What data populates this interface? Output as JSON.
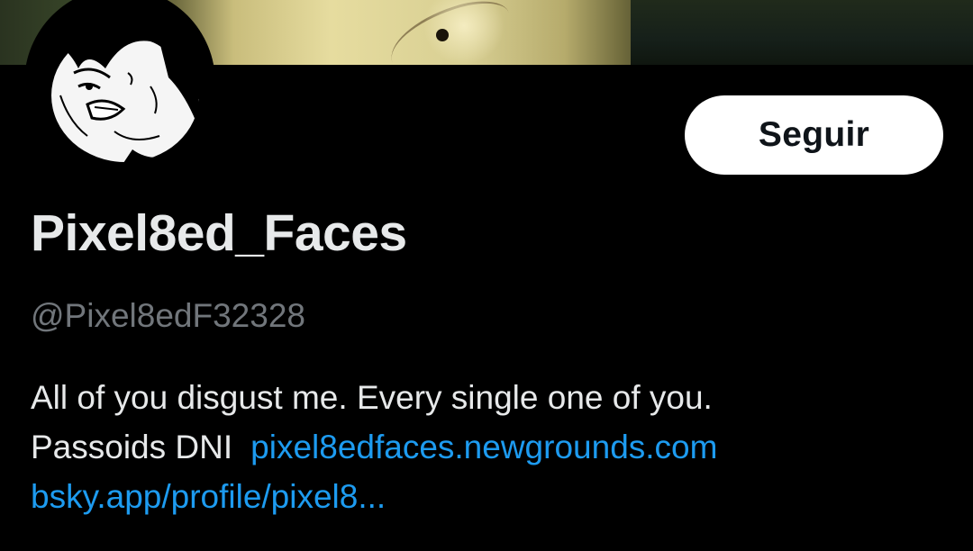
{
  "profile": {
    "display_name": "Pixel8ed_Faces",
    "handle": "@Pixel8edF32328",
    "bio": {
      "line1": "All of you disgust me. Every single one of you.",
      "line2_text": "Passoids DNI",
      "link1": "pixel8edfaces.newgrounds.com",
      "link2": "bsky.app/profile/pixel8..."
    }
  },
  "actions": {
    "follow_label": "Seguir"
  },
  "colors": {
    "background": "#000000",
    "text_primary": "#e7e9ea",
    "text_secondary": "#71767b",
    "link": "#1d9bf0",
    "button_bg": "#ffffff",
    "button_text": "#0f1419"
  },
  "icons": {
    "avatar": "avatar-image",
    "banner": "banner-image"
  }
}
